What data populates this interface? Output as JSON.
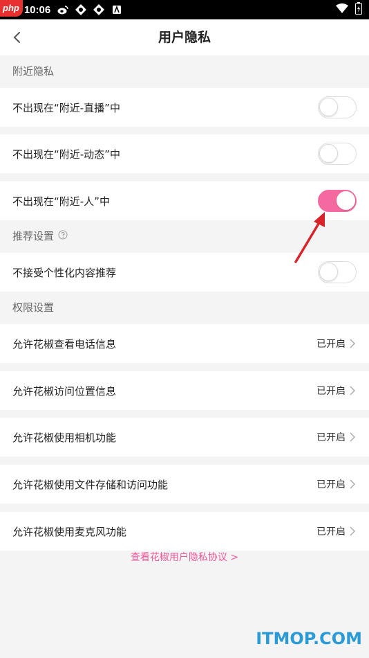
{
  "status_bar": {
    "badge": "php",
    "time": "10:06"
  },
  "header": {
    "title": "用户隐私"
  },
  "sections": [
    {
      "title": "附近隐私",
      "rows": [
        {
          "label": "不出现在“附近-直播”中",
          "toggle": false
        },
        {
          "label": "不出现在“附近-动态”中",
          "toggle": false
        },
        {
          "label": "不出现在“附近-人”中",
          "toggle": true
        }
      ]
    },
    {
      "title": "推荐设置",
      "has_help_icon": true,
      "rows": [
        {
          "label": "不接受个性化内容推荐",
          "toggle": false
        }
      ]
    },
    {
      "title": "权限设置",
      "rows": [
        {
          "label": "允许花椒查看电话信息",
          "status": "已开启"
        },
        {
          "label": "允许花椒访问位置信息",
          "status": "已开启"
        },
        {
          "label": "允许花椒使用相机功能",
          "status": "已开启"
        },
        {
          "label": "允许花椒使用文件存储和访问功能",
          "status": "已开启"
        },
        {
          "label": "允许花椒使用麦克风功能",
          "status": "已开启"
        }
      ]
    }
  ],
  "footer": {
    "link": "查看花椒用户隐私协议 >"
  },
  "watermark": "ITMOP.COM",
  "colors": {
    "accent": "#f46aa0",
    "link": "#f0579a",
    "background": "#f4f4f4",
    "arrow": "#d9232a",
    "watermark": "#2a9bd6"
  }
}
